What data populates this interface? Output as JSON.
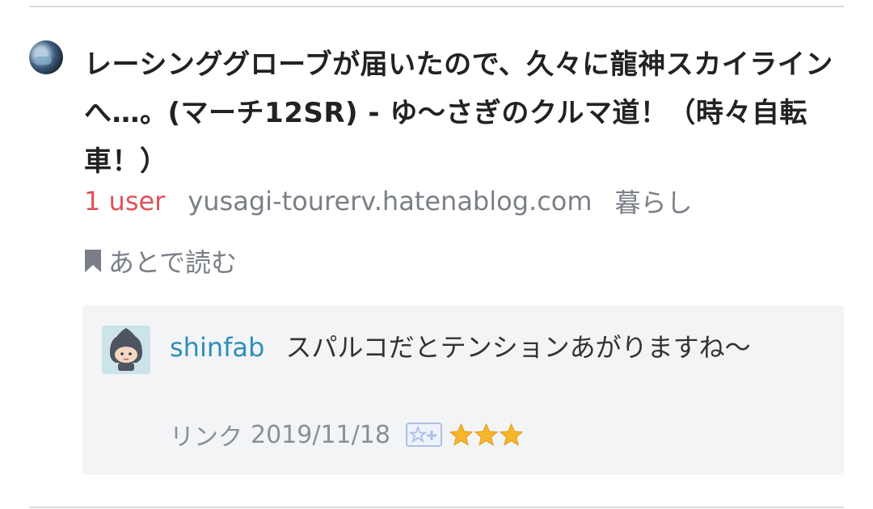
{
  "entry": {
    "title": "レーシンググローブが届いたので、久々に龍神スカイラインへ…。(マーチ12SR) - ゆ〜さぎのクルマ道！（時々自転車！）",
    "users": "1 user",
    "domain": "yusagi-tourerv.hatenablog.com",
    "category": "暮らし",
    "read_later_label": "あとで読む",
    "favicon_icon": "site-favicon"
  },
  "comment": {
    "user": "shinfab",
    "text": "スパルコだとテンションあがりますね〜",
    "link_label": "リンク",
    "date": "2019/11/18",
    "star_count": 3,
    "star_color": "#f5b62a"
  },
  "colors": {
    "users_count": "#e0525a",
    "username": "#2d8fb8",
    "muted_text": "#7a7f87",
    "comment_bg": "#f3f4f6"
  }
}
